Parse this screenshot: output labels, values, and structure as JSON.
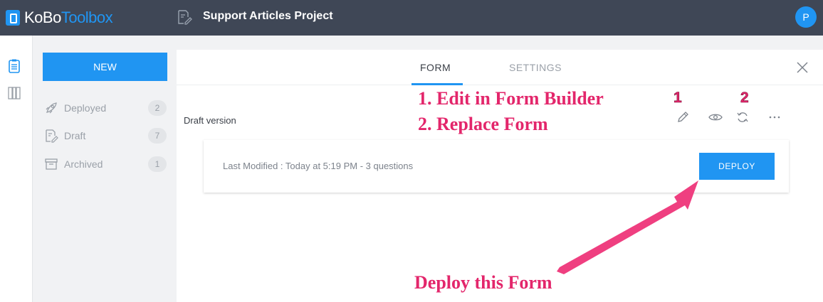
{
  "header": {
    "logo_kobo": "KoBo",
    "logo_toolbox": "Toolbox",
    "project_title": "Support Articles Project",
    "avatar_letter": "P"
  },
  "sidebar": {
    "new_label": "NEW",
    "items": [
      {
        "label": "Deployed",
        "count": "2",
        "icon": "rocket-icon"
      },
      {
        "label": "Draft",
        "count": "7",
        "icon": "draft-icon"
      },
      {
        "label": "Archived",
        "count": "1",
        "icon": "archive-icon"
      }
    ]
  },
  "tabs": {
    "form": "FORM",
    "settings": "SETTINGS",
    "active": "FORM"
  },
  "form": {
    "draft_label": "Draft version",
    "last_modified": "Last Modified : Today at 5:19 PM - 3 questions",
    "deploy_label": "DEPLOY"
  },
  "annotations": {
    "line1": "1.  Edit in Form Builder",
    "line2": "2.  Replace Form",
    "marker1": "1",
    "marker2": "2",
    "deploy_note": "Deploy this Form"
  },
  "colors": {
    "accent": "#2095f2",
    "topbar": "#3f4756",
    "annotation": "#e3266b"
  }
}
